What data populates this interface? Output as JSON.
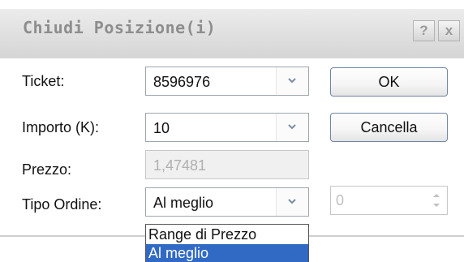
{
  "window": {
    "title": "Chiudi Posizione(i)",
    "help_label": "?",
    "close_label": "x"
  },
  "form": {
    "ticket_label": "Ticket:",
    "ticket_value": "8596976",
    "importo_label": "Importo (K):",
    "importo_value": "10",
    "prezzo_label": "Prezzo:",
    "prezzo_value": "1,47481",
    "tipo_label": "Tipo Ordine:",
    "tipo_value": "Al meglio",
    "range_value": "0"
  },
  "buttons": {
    "ok_label": "OK",
    "cancel_label": "Cancella"
  },
  "dropdown": {
    "options": [
      "Range di Prezzo",
      "Al meglio"
    ],
    "selected": "Al meglio"
  }
}
